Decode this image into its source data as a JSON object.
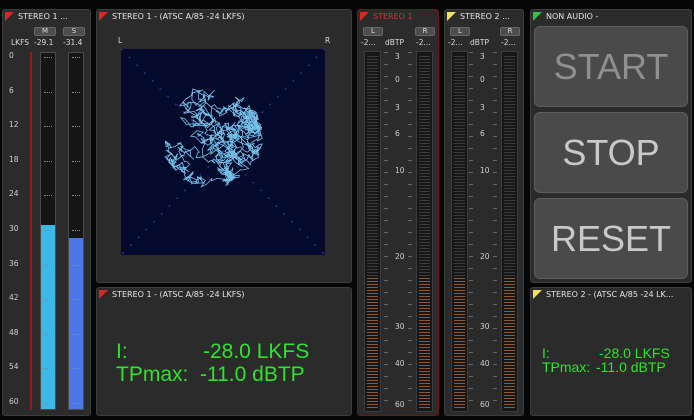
{
  "loudness_meter": {
    "title": "STEREO 1 ...",
    "unit": "LKFS",
    "channel_m_label": "M",
    "channel_s_label": "S",
    "m_value": "-29.1",
    "s_value": "-31.4",
    "scale": [
      "0",
      "6",
      "12",
      "18",
      "24",
      "30",
      "36",
      "42",
      "48",
      "54",
      "60"
    ],
    "m_level_lkfs": -29.1,
    "s_level_lkfs": -31.4,
    "colors": {
      "m_fill": "#3db7e6",
      "s_fill": "#4a79e6",
      "marker": "#a82020"
    }
  },
  "vectorscope": {
    "title": "STEREO 1 - (ATSC A/85 -24 LKFS)",
    "left_label": "L",
    "right_label": "R",
    "colors": {
      "background": "#040a2c",
      "trace": "#77c2ea"
    }
  },
  "loudness_summary_1": {
    "title": "STEREO 1 - (ATSC A/85 -24 LKFS)",
    "integrated_label": "I:",
    "integrated_value": "-28.0 LKFS",
    "tpmax_label": "TPmax:",
    "tpmax_value": "-11.0 dBTP"
  },
  "truepeak_stereo1": {
    "title": "STEREO 1",
    "l_label": "L",
    "r_label": "R",
    "l_value": "-2...",
    "r_value": "-2...",
    "unit": "dBTP",
    "scale": [
      "3",
      "0",
      "3",
      "6",
      "10",
      "20",
      "30",
      "40",
      "60"
    ],
    "colors": {
      "title": "#d43030",
      "border": "#6b1818"
    }
  },
  "truepeak_stereo2": {
    "title": "STEREO 2 ...",
    "l_label": "L",
    "r_label": "R",
    "l_value": "-2...",
    "r_value": "-2...",
    "unit": "dBTP",
    "scale": [
      "3",
      "0",
      "3",
      "6",
      "10",
      "20",
      "30",
      "40",
      "60"
    ]
  },
  "non_audio": {
    "title": "NON AUDIO -",
    "start_label": "START",
    "stop_label": "STOP",
    "reset_label": "RESET"
  },
  "loudness_summary_2": {
    "title": "STEREO 2 - (ATSC A/85 -24 LK...",
    "integrated_label": "I:",
    "integrated_value": "-28.0 LKFS",
    "tpmax_label": "TPmax:",
    "tpmax_value": "-11.0 dBTP"
  }
}
